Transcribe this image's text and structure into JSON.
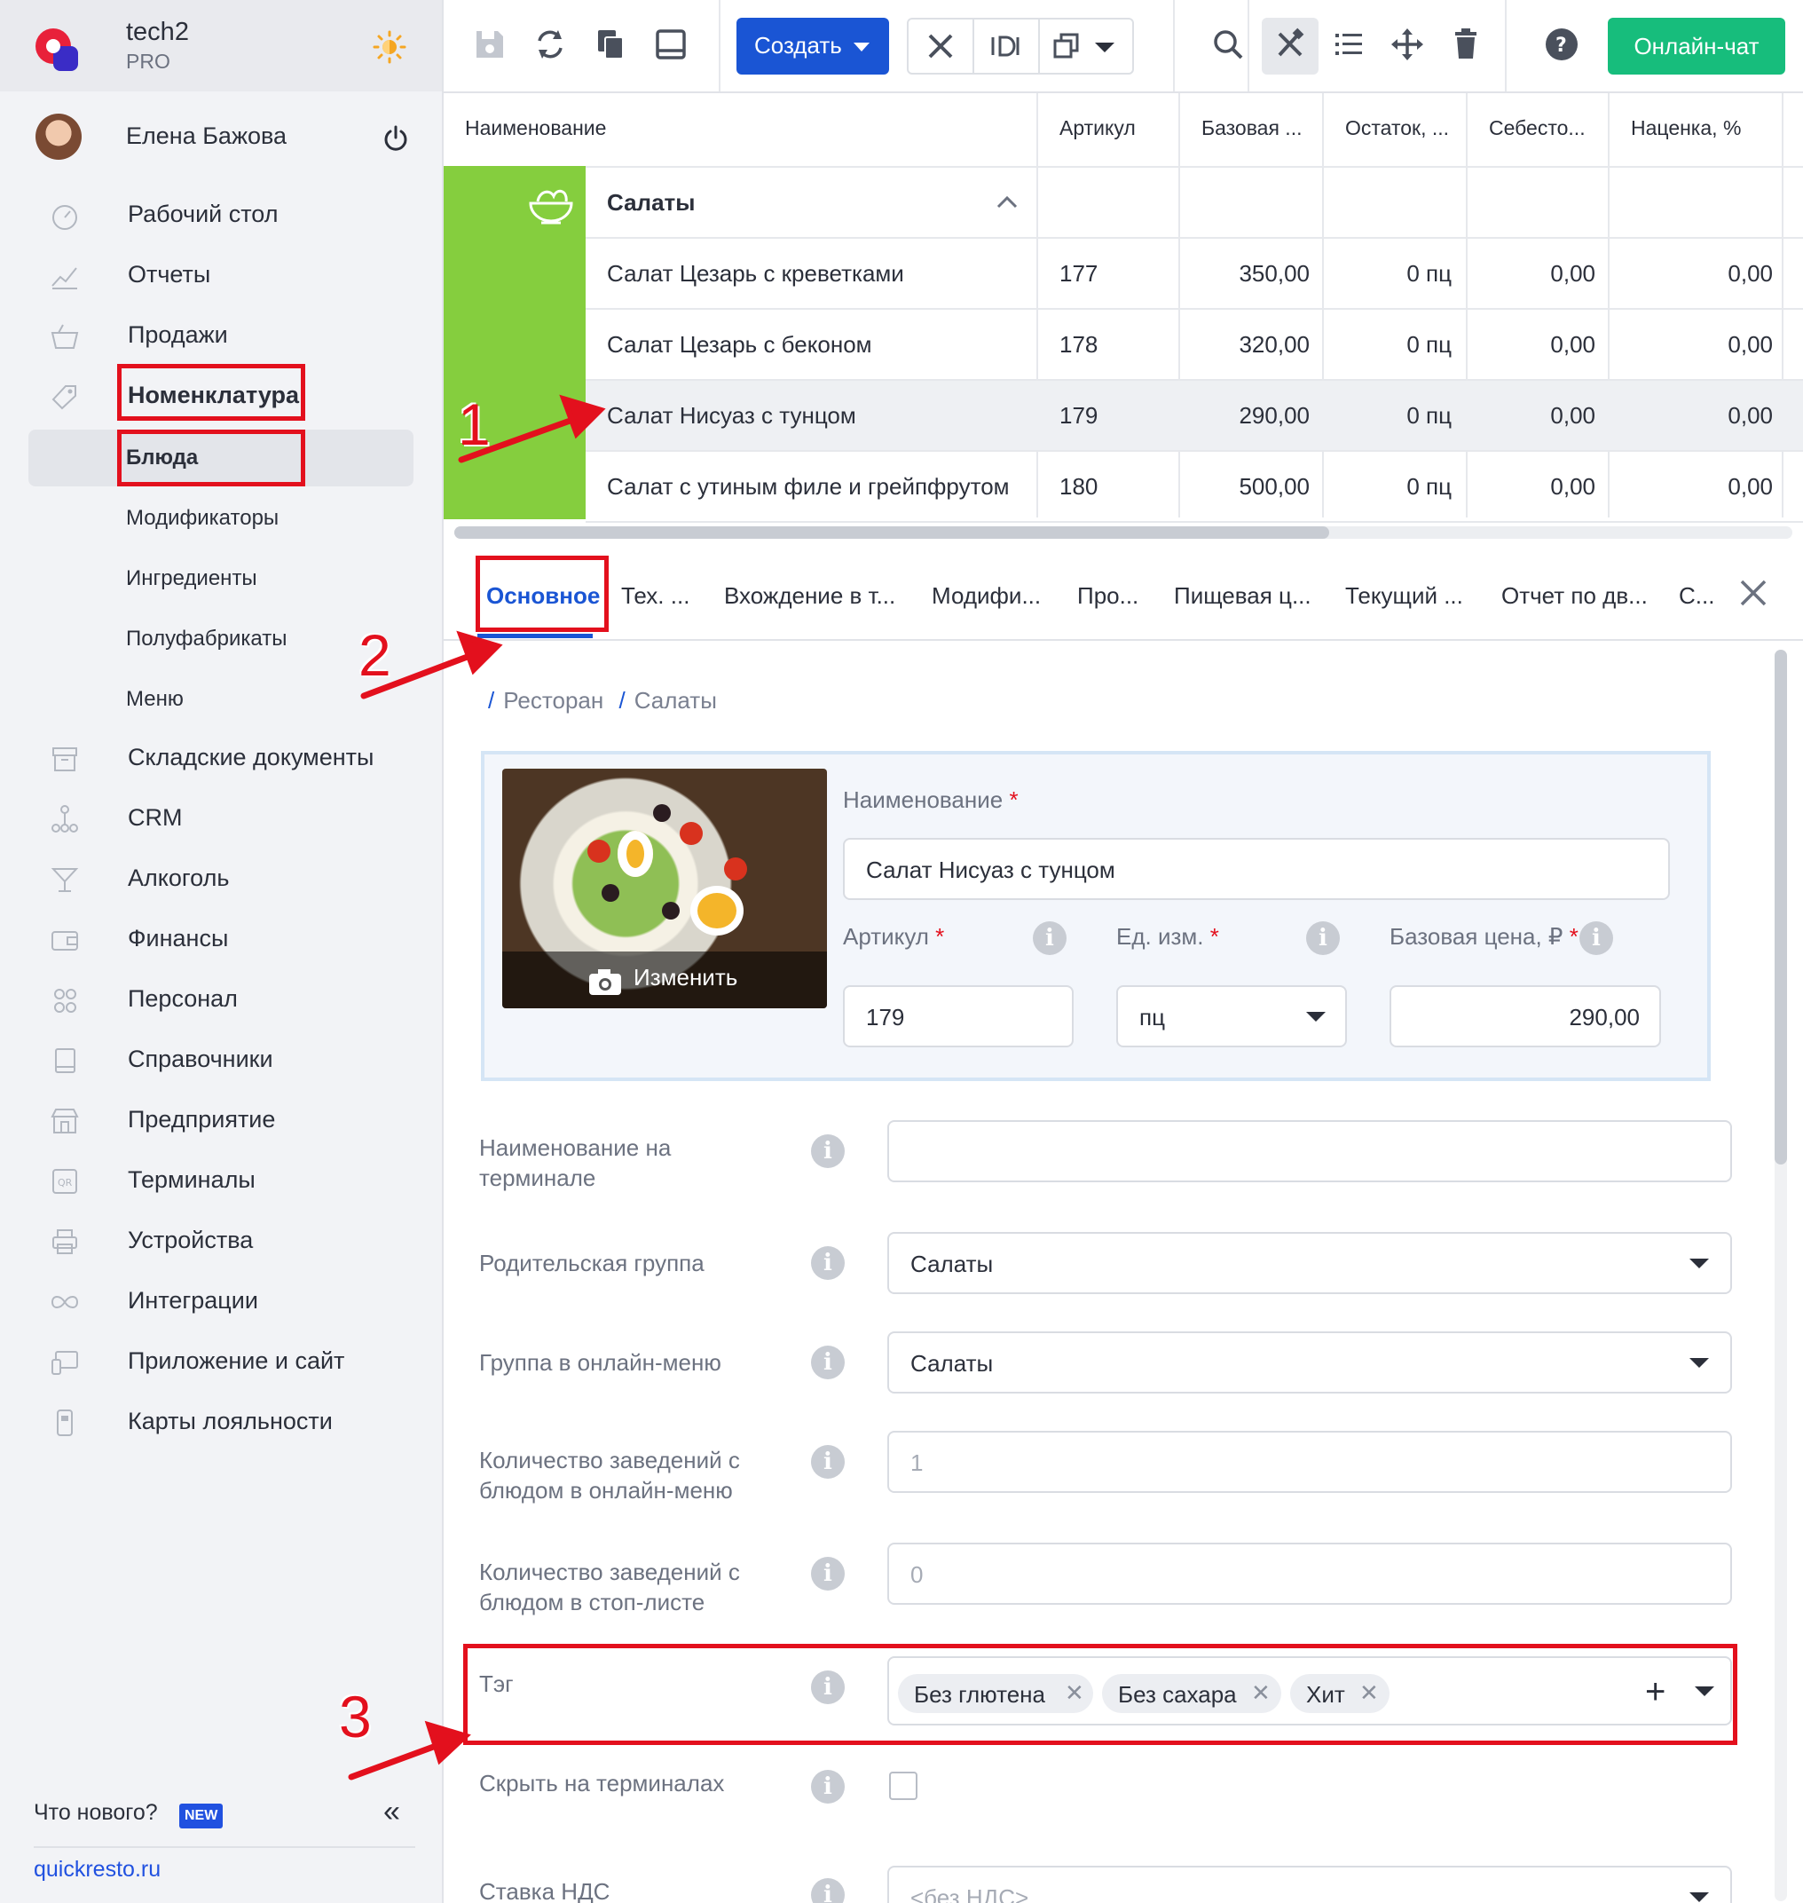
{
  "app": {
    "name": "tech2",
    "plan": "PRO"
  },
  "user": {
    "name": "Елена Бажова"
  },
  "sidebar": {
    "items": [
      {
        "label": "Рабочий стол",
        "icon": "dashboard-icon"
      },
      {
        "label": "Отчеты",
        "icon": "reports-icon"
      },
      {
        "label": "Продажи",
        "icon": "basket-icon"
      },
      {
        "label": "Номенклатура",
        "icon": "tag-icon"
      },
      {
        "label": "Складские документы",
        "icon": "archive-icon"
      },
      {
        "label": "CRM",
        "icon": "hierarchy-icon"
      },
      {
        "label": "Алкоголь",
        "icon": "cocktail-icon"
      },
      {
        "label": "Финансы",
        "icon": "wallet-icon"
      },
      {
        "label": "Персонал",
        "icon": "people-icon"
      },
      {
        "label": "Справочники",
        "icon": "book-icon"
      },
      {
        "label": "Предприятие",
        "icon": "store-icon"
      },
      {
        "label": "Терминалы",
        "icon": "qr-icon"
      },
      {
        "label": "Устройства",
        "icon": "printer-icon"
      },
      {
        "label": "Интеграции",
        "icon": "infinity-icon"
      },
      {
        "label": "Приложение и сайт",
        "icon": "devices-icon"
      },
      {
        "label": "Карты лояльности",
        "icon": "card-icon"
      }
    ],
    "subitems": [
      "Блюда",
      "Модификаторы",
      "Ингредиенты",
      "Полуфабрикаты",
      "Меню"
    ],
    "whats_new": "Что нового?",
    "new_badge": "NEW",
    "site_link": "quickresto.ru"
  },
  "toolbar": {
    "create_label": "Создать",
    "chat_label": "Онлайн-чат"
  },
  "table": {
    "columns": [
      "Наименование",
      "Артикул",
      "Базовая ...",
      "Остаток, ...",
      "Себесто...",
      "Наценка, %"
    ],
    "group": "Салаты",
    "rows": [
      {
        "name": "Салат Цезарь с креветками",
        "sku": "177",
        "price": "350,00",
        "stock": "0 пц",
        "cost": "0,00",
        "markup": "0,00"
      },
      {
        "name": "Салат Цезарь с беконом",
        "sku": "178",
        "price": "320,00",
        "stock": "0 пц",
        "cost": "0,00",
        "markup": "0,00"
      },
      {
        "name": "Салат Нисуаз с тунцом",
        "sku": "179",
        "price": "290,00",
        "stock": "0 пц",
        "cost": "0,00",
        "markup": "0,00"
      },
      {
        "name": "Салат с утиным филе и грейпфрутом",
        "sku": "180",
        "price": "500,00",
        "stock": "0 пц",
        "cost": "0,00",
        "markup": "0,00"
      }
    ]
  },
  "tabs": [
    "Основное",
    "Тех. ...",
    "Вхождение в т...",
    "Модифи...",
    "Про...",
    "Пищевая ц...",
    "Текущий ...",
    "Отчет по дв...",
    "С..."
  ],
  "form": {
    "breadcrumb": [
      "Ресторан",
      "Салаты"
    ],
    "photo_action": "Изменить",
    "name_label": "Наименование",
    "name_value": "Салат Нисуаз с тунцом",
    "sku_label": "Артикул",
    "sku_value": "179",
    "unit_label": "Ед. изм.",
    "unit_value": "пц",
    "price_label": "Базовая цена, ₽",
    "price_value": "290,00",
    "terminal_name_label": "Наименование на терминале",
    "terminal_name_value": "",
    "parent_group_label": "Родительская группа",
    "parent_group_value": "Салаты",
    "online_group_label": "Группа в онлайн-меню",
    "online_group_value": "Салаты",
    "online_count_label": "Количество заведений с блюдом в онлайн-меню",
    "online_count_value": "1",
    "stop_count_label": "Количество заведений с блюдом в стоп-листе",
    "stop_count_value": "0",
    "tag_label": "Тэг",
    "tags": [
      "Без глютена",
      "Без сахара",
      "Хит"
    ],
    "hide_label": "Скрыть на терминалах",
    "vat_label": "Ставка НДС",
    "vat_placeholder": "<без НДС>"
  },
  "annotations": [
    "1",
    "2",
    "3"
  ],
  "colors": {
    "accent": "#1a55d4",
    "chat": "#17bd7c",
    "group": "#85ce3e",
    "highlight": "#e3101d"
  }
}
